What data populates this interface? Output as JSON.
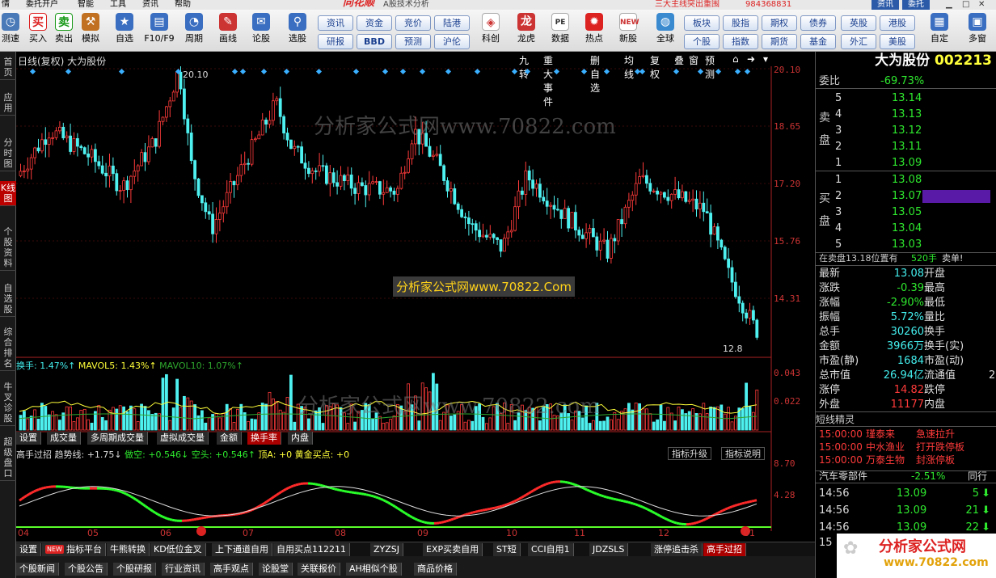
{
  "menu": [
    "情",
    "委托开户",
    "智能",
    "工具",
    "资讯",
    "帮助"
  ],
  "menu_right": {
    "banner": "三大主线突出重围",
    "phone": "984368831",
    "news_btn": "资讯",
    "trade_btn": "委托"
  },
  "toolbar": {
    "buttons": [
      "测速",
      "买入",
      "卖出",
      "模拟",
      "自选",
      "F10/F9",
      "周期",
      "画线",
      "论股",
      "选股",
      "科创",
      "龙虎",
      "数据",
      "热点",
      "新股",
      "全球",
      "自定",
      "多窗"
    ],
    "pills_top": [
      "资讯",
      "资金",
      "竞价",
      "陆港",
      "板块",
      "股指",
      "期权",
      "债券",
      "英股",
      "港股"
    ],
    "pills_bottom": [
      "研报",
      "BBD",
      "预测",
      "沪伦",
      "个股",
      "指数",
      "期货",
      "基金",
      "外汇",
      "美股"
    ],
    "logo": "同花顺",
    "app_title": "A股技术分析"
  },
  "sidebar": [
    "首页",
    "应用",
    "分时图",
    "K线图",
    "个股资料",
    "自选股",
    "综合排名",
    "牛叉诊股",
    "超级盘口"
  ],
  "chart": {
    "title": "日线(复权) 大为股份",
    "top_buttons": [
      "九转",
      "重大事件",
      "删自选",
      "均线",
      "复权",
      "叠",
      "窗",
      "预测"
    ],
    "price_axis": [
      "20.10",
      "18.65",
      "17.20",
      "15.76",
      "14.31"
    ],
    "high_label": "20.10",
    "low_label": "12.8",
    "watermark1": "分析家公式网www.70822.com",
    "watermark_box": "分析家公式网www.70822.Com",
    "vol_legend": {
      "a": "换手: 1.47%↑",
      "b": "MAVOL5: 1.43%↑",
      "c": "MAVOL10: 1.07%↑"
    },
    "vol_axis": [
      "0.043",
      "0.022"
    ],
    "vol_tabs": [
      "设置",
      "成交量",
      "多周期成交量",
      "虚拟成交量",
      "金额",
      "换手率",
      "内盘"
    ],
    "ind_legend": {
      "name": "高手过招",
      "trend": "趋势线: +1.75↓",
      "long": "做空: +0.546↓",
      "short": "空头: +0.546↑",
      "top": "顶A: +0",
      "gold": "黄金买点: +0"
    },
    "ind_buttons": [
      "指标升级",
      "指标说明"
    ],
    "ind_axis": [
      "8.70",
      "4.28"
    ],
    "x_axis": [
      "04",
      "05",
      "06",
      "07",
      "08",
      "09",
      "10",
      "11",
      "12",
      "01"
    ],
    "bottom_tabs": [
      "设置",
      "指标平台",
      "牛熊转换",
      "KD低位金叉",
      "上下通道自用",
      "自用买点112211",
      "ZYZSJ",
      "EXP买卖自用",
      "ST短",
      "CCI自用1",
      "JDZSLS",
      "涨停追击杀",
      "高手过招"
    ],
    "bottom_row2": [
      "个股新闻",
      "个股公告",
      "个股研报",
      "行业资讯",
      "高手观点",
      "论股堂",
      "关联报价",
      "AH相似个股",
      "商品价格"
    ],
    "new_badge": "NEW"
  },
  "quote": {
    "name": "大为股份",
    "code": "002213",
    "weibi_label": "委比",
    "weibi": "-69.73%",
    "sell_label": "卖盘",
    "buy_label": "买盘",
    "asks": [
      [
        "5",
        "13.14"
      ],
      [
        "4",
        "13.13"
      ],
      [
        "3",
        "13.12"
      ],
      [
        "2",
        "13.11"
      ],
      [
        "1",
        "13.09"
      ]
    ],
    "bids": [
      [
        "1",
        "13.08"
      ],
      [
        "2",
        "13.07"
      ],
      [
        "3",
        "13.05"
      ],
      [
        "4",
        "13.04"
      ],
      [
        "5",
        "13.03"
      ]
    ],
    "notice": "在卖盘13.18位置有",
    "notice_vol": "520手",
    "notice_act": "卖单!",
    "stats": [
      [
        "最新",
        "13.08",
        "开盘"
      ],
      [
        "涨跌",
        "-0.39",
        "最高"
      ],
      [
        "涨幅",
        "-2.90%",
        "最低"
      ],
      [
        "振幅",
        "5.72%",
        "量比"
      ],
      [
        "总手",
        "30260",
        "换手"
      ],
      [
        "金额",
        "3966万",
        "换手(实)"
      ],
      [
        "市盈(静)",
        "1684",
        "市盈(动)"
      ],
      [
        "总市值",
        "26.94亿",
        "流通值"
      ],
      [
        "涨停",
        "14.82",
        "跌停"
      ],
      [
        "外盘",
        "11177",
        "内盘"
      ]
    ],
    "float_val": "2",
    "elf_title": "短线精灵",
    "elf": [
      [
        "15:00:00",
        "瑾泰来",
        "急速拉升"
      ],
      [
        "15:00:00",
        "中水渔业",
        "打开跌停板"
      ],
      [
        "15:00:00",
        "万泰生物",
        "封涨停板"
      ]
    ],
    "sector": "汽车零部件",
    "sector_pct": "-2.51%",
    "sector_btn": "同行",
    "ticks": [
      [
        "14:56",
        "13.09",
        "5"
      ],
      [
        "14:56",
        "13.09",
        "21"
      ],
      [
        "14:56",
        "13.09",
        "22"
      ]
    ],
    "tick_partial": "15",
    "footer_logo": "分析家公式网",
    "footer_url": "www.70822.com"
  }
}
